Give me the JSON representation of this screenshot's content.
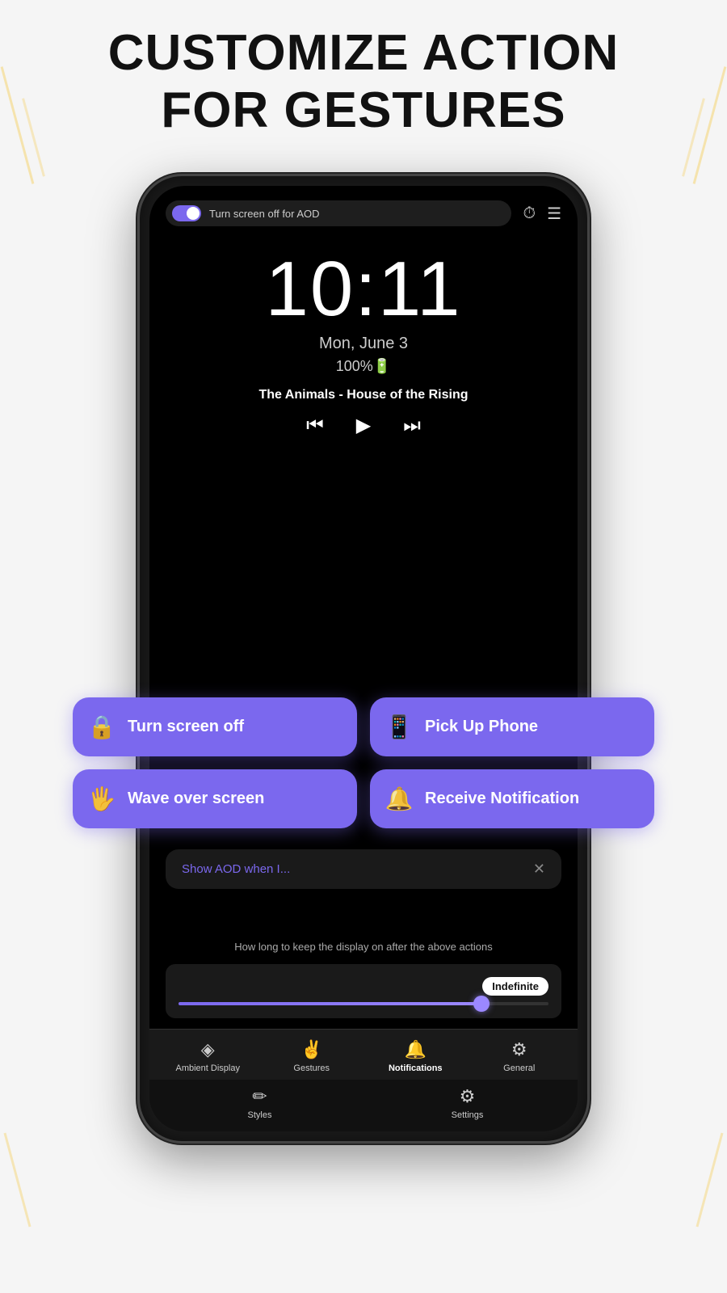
{
  "page": {
    "title_line1": "CUSTOMIZE ACTION",
    "title_line2": "FOR GESTURES",
    "background_color": "#f5f5f5"
  },
  "phone": {
    "toggle_label": "Turn screen off for AOD",
    "clock_time": "10:11",
    "clock_date": "Mon, June 3",
    "clock_battery": "100%🔋",
    "music_title": "The Animals - House of the Rising",
    "aod_panel_title": "Show AOD when I...",
    "duration_text": "How long to keep the display on after the above actions",
    "indefinite_label": "Indefinite",
    "gesture_buttons": [
      {
        "id": "turn-screen-off",
        "icon": "🔒",
        "label": "Turn screen off"
      },
      {
        "id": "pick-up-phone",
        "icon": "📱",
        "label": "Pick Up Phone"
      },
      {
        "id": "wave-over-screen",
        "icon": "✋",
        "label": "Wave over screen"
      },
      {
        "id": "receive-notification",
        "icon": "🔔",
        "label": "Receive Notification"
      }
    ],
    "nav_items_row1": [
      {
        "id": "ambient-display",
        "icon": "◈",
        "label": "Ambient Display",
        "active": false
      },
      {
        "id": "gestures",
        "icon": "☞",
        "label": "Gestures",
        "active": false
      },
      {
        "id": "notifications",
        "icon": "🔔",
        "label": "Notifications",
        "active": true
      },
      {
        "id": "general",
        "icon": "⚙",
        "label": "General",
        "active": false
      }
    ],
    "nav_items_row2": [
      {
        "id": "styles",
        "icon": "✏",
        "label": "Styles",
        "active": false
      },
      {
        "id": "settings",
        "icon": "⚙",
        "label": "Settings",
        "active": false
      }
    ]
  }
}
